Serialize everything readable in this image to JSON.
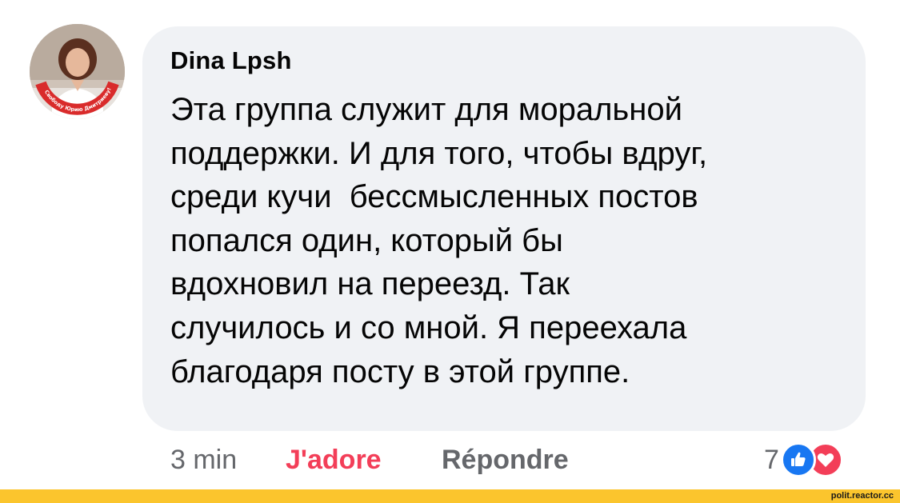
{
  "comment": {
    "author": "Dina Lpsh",
    "avatar_caption": "Свободу Юрию Дмитриеву!",
    "text_lines": [
      "Эта группа служит для моральной",
      "поддержки. И для того, чтобы вдруг,",
      "среди кучи  бессмысленных постов",
      "попался один, который бы",
      "вдохновил на переезд. Так",
      "случилось и со мной. Я переехала",
      "благодаря посту в этой группе."
    ]
  },
  "actions": {
    "time": "3 min",
    "like_label": "J'adore",
    "reply_label": "Répondre"
  },
  "reactions": {
    "count": "7",
    "icons": [
      "thumbs-up-icon",
      "heart-icon"
    ]
  },
  "footer": {
    "watermark": "polit.reactor.cc"
  },
  "colors": {
    "bubble_bg": "#f0f2f5",
    "like_active": "#f33e58",
    "meta_gray": "#65676b",
    "like_blue": "#1877f2",
    "footer_yellow": "#fbc52d"
  }
}
